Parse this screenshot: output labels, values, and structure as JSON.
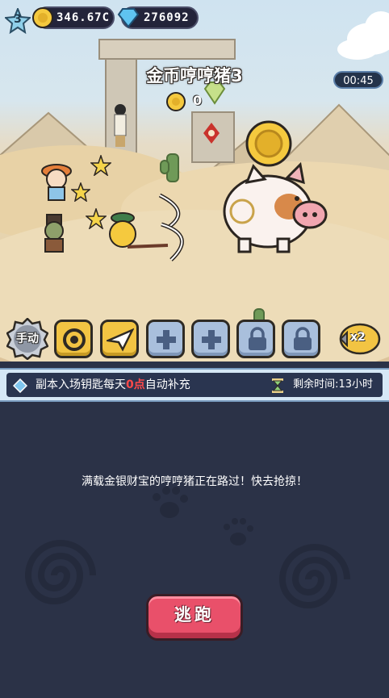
{
  "hud": {
    "level": "3",
    "gold": "346.67C",
    "gems": "276092",
    "timer": "00:45"
  },
  "stage": {
    "title": "金币哼哼猪3",
    "coins_collected": "0"
  },
  "skills": {
    "manual_label": "手动",
    "speed_label": "x2"
  },
  "notice": {
    "text_before": "副本入场钥匙每天",
    "text_highlight": "0点",
    "text_after": "自动补充",
    "time_remaining": "剩余时间:13小时",
    "highlight_color": "#ff4a4a"
  },
  "panel": {
    "message": "满载金银财宝的哼哼猪正在路过！快去抢掠！",
    "flee_label": "逃跑"
  },
  "colors": {
    "flee_button": "#e9506a",
    "skill_gold": "#f2c443",
    "skill_blue": "#a9bfdc",
    "panel_bg": "#2b3247"
  }
}
